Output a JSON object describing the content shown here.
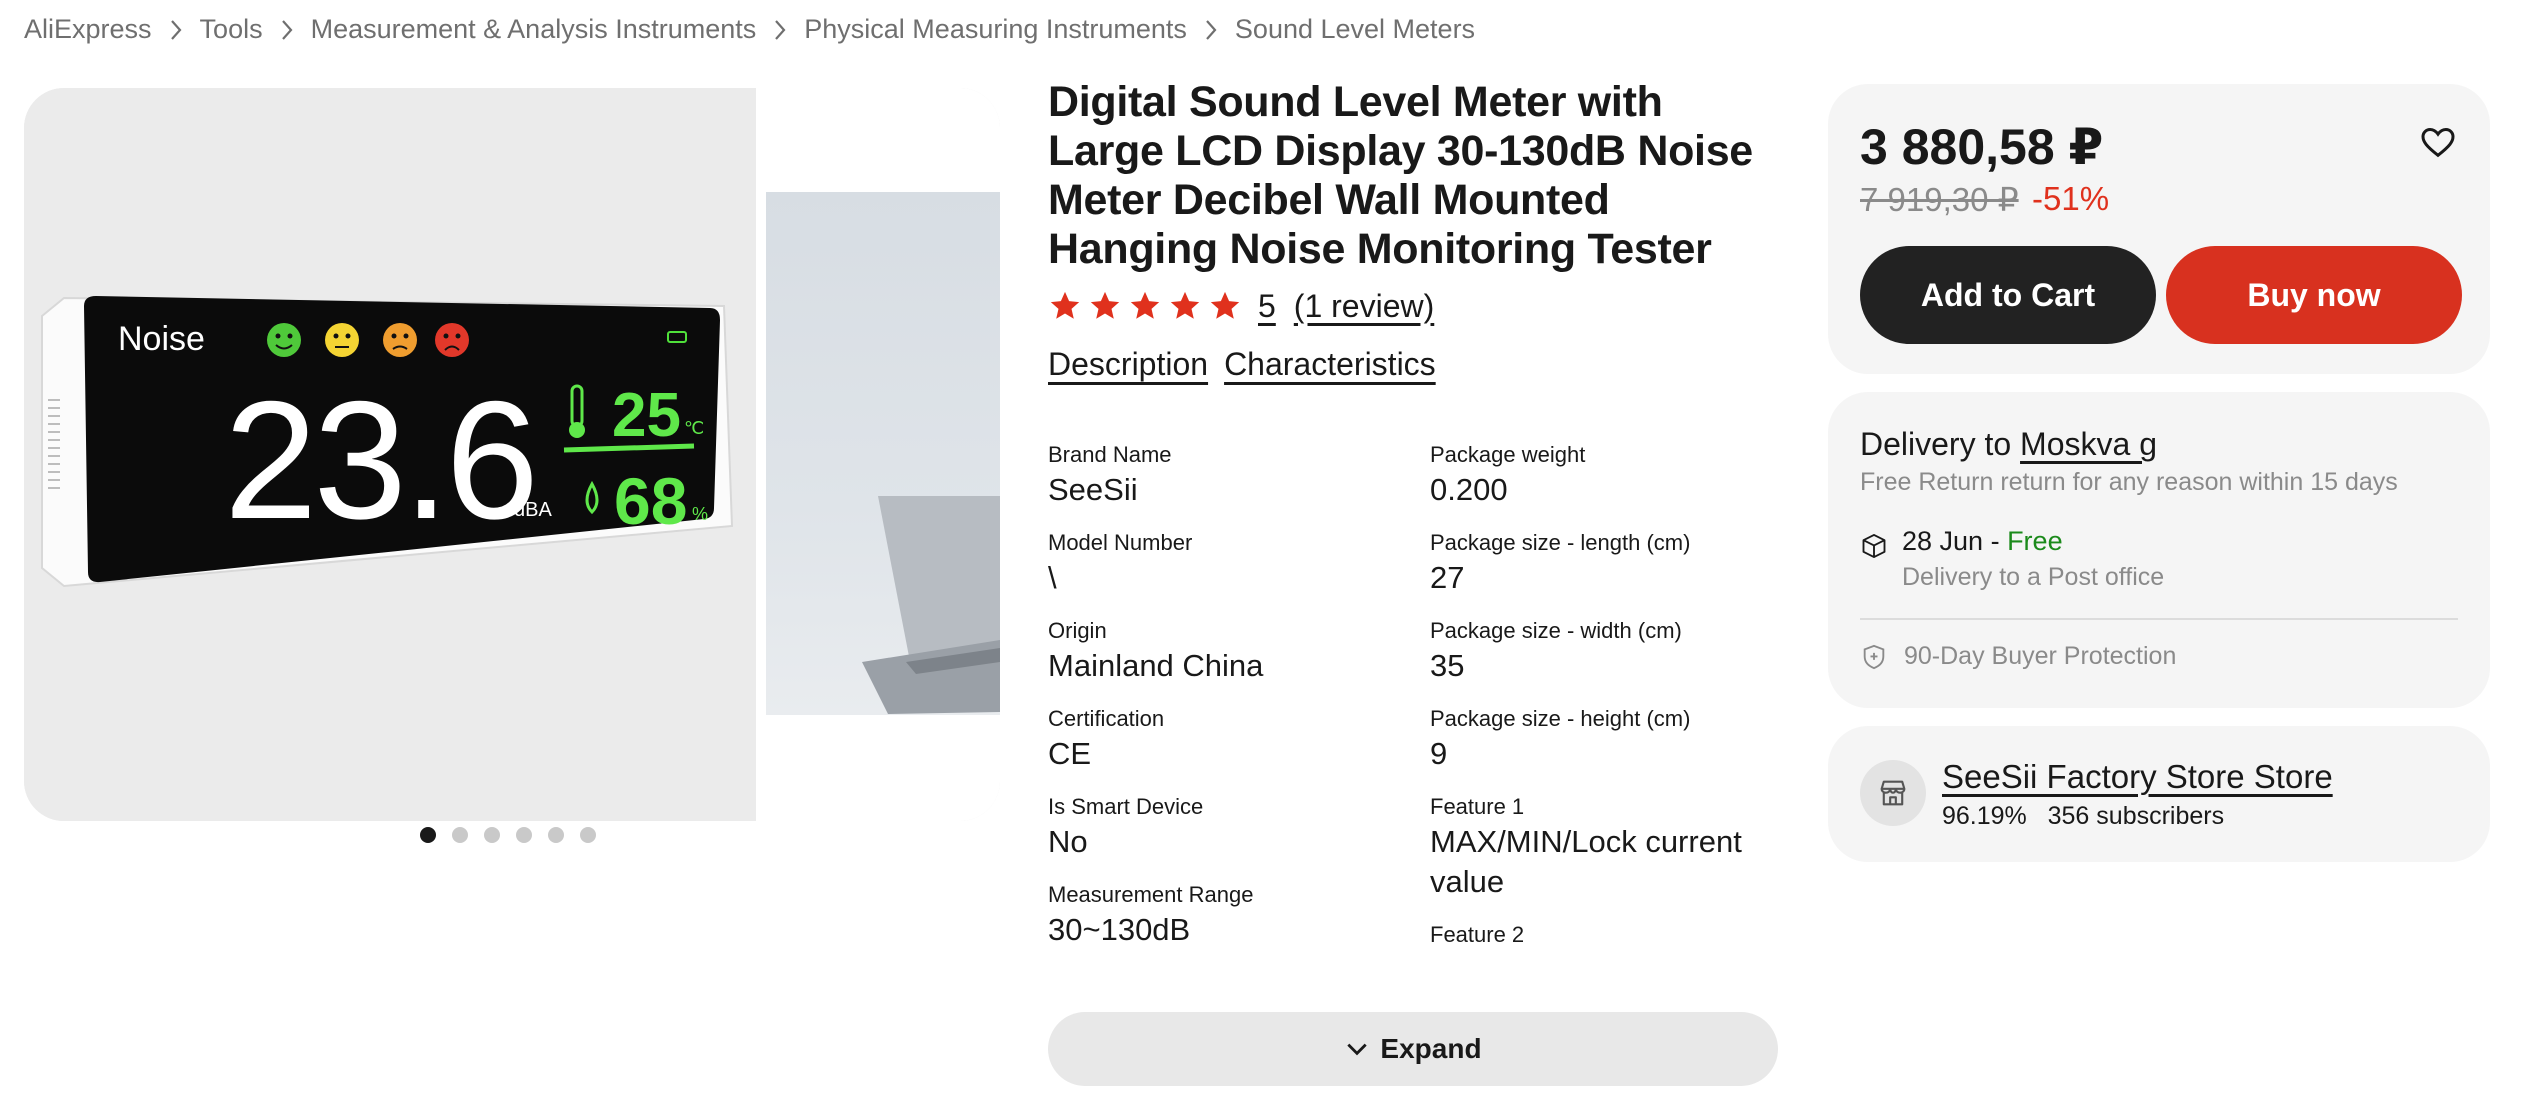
{
  "breadcrumb": [
    "AliExpress",
    "Tools",
    "Measurement & Analysis Instruments",
    "Physical Measuring Instruments",
    "Sound Level Meters"
  ],
  "gallery": {
    "slide_count": 6,
    "active_index": 0,
    "device_display": {
      "label": "Noise",
      "reading": "23.6",
      "unit": "dBA",
      "temperature": "25",
      "temperature_unit": "℃",
      "humidity": "68",
      "humidity_unit": "%"
    }
  },
  "product": {
    "title": "Digital Sound Level Meter with Large LCD Display 30-130dB Noise Meter Decibel Wall Mounted Hanging Noise Monitoring Tester",
    "rating": "5",
    "stars": 5,
    "reviews_link": "(1 review)",
    "tabs": [
      "Description",
      "Characteristics"
    ]
  },
  "specs": {
    "left": [
      {
        "key": "Brand Name",
        "value": "SeeSii"
      },
      {
        "key": "Model Number",
        "value": "\\"
      },
      {
        "key": "Origin",
        "value": "Mainland China"
      },
      {
        "key": "Certification",
        "value": "CE"
      },
      {
        "key": "Is Smart Device",
        "value": "No"
      },
      {
        "key": "Measurement Range",
        "value": "30~130dB"
      }
    ],
    "right": [
      {
        "key": "Package weight",
        "value": "0.200"
      },
      {
        "key": "Package size - length (cm)",
        "value": "27"
      },
      {
        "key": "Package size - width (cm)",
        "value": "35"
      },
      {
        "key": "Package size - height (cm)",
        "value": "9"
      },
      {
        "key": "Feature 1",
        "value": "MAX/MIN/Lock current value"
      },
      {
        "key": "Feature 2",
        "value": ""
      }
    ],
    "expand_label": "Expand"
  },
  "buybox": {
    "price": "3 880,58 ₽",
    "old_price": "7 919,30 ₽",
    "discount": "-51%",
    "add_to_cart": "Add to Cart",
    "buy_now": "Buy now"
  },
  "delivery": {
    "title_prefix": "Delivery to ",
    "city": "Moskva g",
    "return_note": "Free Return return for any reason within 15 days",
    "date": "28 Jun - ",
    "free": "Free",
    "method": "Delivery to a Post office",
    "protection": "90-Day Buyer Protection"
  },
  "store": {
    "name": "SeeSii Factory Store Store",
    "stats": "96.19%   356 subscribers"
  },
  "colors": {
    "accent_red": "#d8311f",
    "star": "#e0311d",
    "free_green": "#1b8a1b",
    "dark_button": "#222222",
    "display_green": "#5fe84a"
  }
}
